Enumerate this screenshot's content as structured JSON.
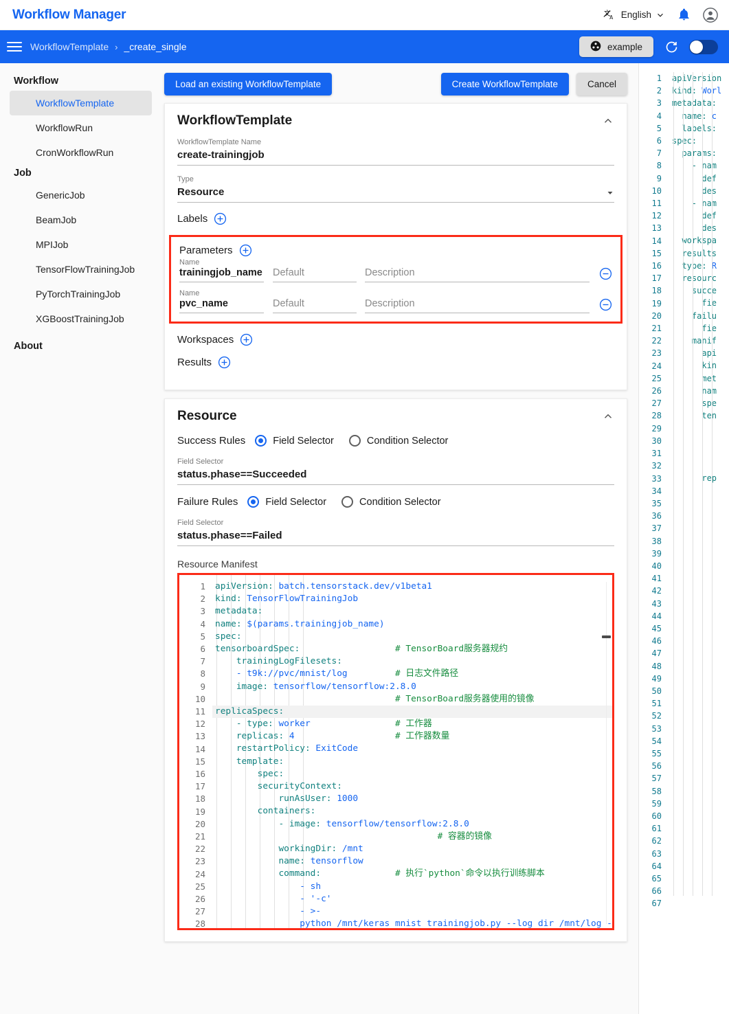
{
  "header": {
    "brand": "Workflow Manager",
    "language_icon": "translate-icon",
    "language": "English",
    "chevron": "chevron-down-icon",
    "bell": "bell-icon",
    "avatar": "account-circle-icon"
  },
  "toolbar": {
    "menu_icon": "hamburger-menu-icon",
    "breadcrumb_root": "WorkflowTemplate",
    "breadcrumb_sep": "›",
    "breadcrumb_current": "_create_single",
    "project_chip_icon": "project-icon",
    "project_chip_label": "example",
    "refresh_icon": "refresh-icon",
    "toggle_icon": "theme-toggle",
    "accent": "#1565f0"
  },
  "sidebar": {
    "groups": [
      {
        "label": "Workflow",
        "items": [
          {
            "label": "WorkflowTemplate",
            "active": true
          },
          {
            "label": "WorkflowRun",
            "active": false
          },
          {
            "label": "CronWorkflowRun",
            "active": false
          }
        ]
      },
      {
        "label": "Job",
        "items": [
          {
            "label": "GenericJob",
            "active": false
          },
          {
            "label": "BeamJob",
            "active": false
          },
          {
            "label": "MPIJob",
            "active": false
          },
          {
            "label": "TensorFlowTrainingJob",
            "active": false
          },
          {
            "label": "PyTorchTrainingJob",
            "active": false
          },
          {
            "label": "XGBoostTrainingJob",
            "active": false
          }
        ]
      }
    ],
    "about_label": "About"
  },
  "actions": {
    "load_existing": "Load an existing WorkflowTemplate",
    "create": "Create WorkflowTemplate",
    "cancel": "Cancel"
  },
  "template_card": {
    "title": "WorkflowTemplate",
    "collapse_icon": "chevron-up-icon",
    "name_label": "WorkflowTemplate Name",
    "name_value": "create-trainingjob",
    "type_label": "Type",
    "type_value": "Resource",
    "type_caret": "dropdown-caret-icon",
    "labels_label": "Labels",
    "labels_add_icon": "plus-circle-icon",
    "parameters_label": "Parameters",
    "parameters_add_icon": "plus-circle-icon",
    "parameters": [
      {
        "sublabel": "Name",
        "name": "trainingjob_name",
        "default_placeholder": "Default",
        "description_placeholder": "Description",
        "remove_icon": "minus-circle-icon"
      },
      {
        "sublabel": "Name",
        "name": "pvc_name",
        "default_placeholder": "Default",
        "description_placeholder": "Description",
        "remove_icon": "minus-circle-icon"
      }
    ],
    "workspaces_label": "Workspaces",
    "workspaces_add_icon": "plus-circle-icon",
    "results_label": "Results",
    "results_add_icon": "plus-circle-icon"
  },
  "resource_card": {
    "title": "Resource",
    "collapse_icon": "chevron-up-icon",
    "success_rules_label": "Success Rules",
    "success_field_selector_option": "Field Selector",
    "success_condition_selector_option": "Condition Selector",
    "success_selected": "Field Selector",
    "success_field_label": "Field Selector",
    "success_field_value": "status.phase==Succeeded",
    "failure_rules_label": "Failure Rules",
    "failure_field_selector_option": "Field Selector",
    "failure_condition_selector_option": "Condition Selector",
    "failure_selected": "Field Selector",
    "failure_field_label": "Field Selector",
    "failure_field_value": "status.phase==Failed",
    "manifest_label": "Resource Manifest"
  },
  "manifest_editor": {
    "first_line": 1,
    "last_visible_line": 28,
    "active_line": 11,
    "lines": [
      {
        "n": 1,
        "indent": 0,
        "text": "apiVersion: batch.tensorstack.dev/v1beta1",
        "key": "apiVersion",
        "value": "batch.tensorstack.dev/v1beta1",
        "comment": ""
      },
      {
        "n": 2,
        "indent": 0,
        "text": "kind: TensorFlowTrainingJob",
        "key": "kind",
        "value": "TensorFlowTrainingJob",
        "comment": ""
      },
      {
        "n": 3,
        "indent": 0,
        "text": "metadata:",
        "key": "metadata",
        "value": "",
        "comment": ""
      },
      {
        "n": 4,
        "indent": 0,
        "text": "name: $(params.trainingjob_name)",
        "key": "name",
        "value": "$(params.trainingjob_name)",
        "comment": ""
      },
      {
        "n": 5,
        "indent": 0,
        "text": "spec:",
        "key": "spec",
        "value": "",
        "comment": ""
      },
      {
        "n": 6,
        "indent": 0,
        "text": "tensorboardSpec:",
        "key": "tensorboardSpec",
        "value": "",
        "comment": "# TensorBoard服务器规约"
      },
      {
        "n": 7,
        "indent": 2,
        "text": "trainingLogFilesets:",
        "key": "trainingLogFilesets",
        "value": "",
        "comment": ""
      },
      {
        "n": 8,
        "indent": 2,
        "text": "- t9k://pvc/mnist/log",
        "key": "",
        "value": "- t9k://pvc/mnist/log",
        "comment": "# 日志文件路径"
      },
      {
        "n": 9,
        "indent": 2,
        "text": "image: tensorflow/tensorflow:2.8.0",
        "key": "image",
        "value": "tensorflow/tensorflow:2.8.0",
        "comment": ""
      },
      {
        "n": 10,
        "indent": 2,
        "text": "",
        "key": "",
        "value": "",
        "comment": "# TensorBoard服务器使用的镜像"
      },
      {
        "n": 11,
        "indent": 0,
        "text": "replicaSpecs:",
        "key": "replicaSpecs",
        "value": "",
        "comment": ""
      },
      {
        "n": 12,
        "indent": 2,
        "text": "- type: worker",
        "key": "type",
        "value": "worker",
        "comment": "# 工作器"
      },
      {
        "n": 13,
        "indent": 2,
        "text": "replicas: 4",
        "key": "replicas",
        "value": "4",
        "comment": "# 工作器数量"
      },
      {
        "n": 14,
        "indent": 2,
        "text": "restartPolicy: ExitCode",
        "key": "restartPolicy",
        "value": "ExitCode",
        "comment": ""
      },
      {
        "n": 15,
        "indent": 2,
        "text": "template:",
        "key": "template",
        "value": "",
        "comment": ""
      },
      {
        "n": 16,
        "indent": 4,
        "text": "spec:",
        "key": "spec",
        "value": "",
        "comment": ""
      },
      {
        "n": 17,
        "indent": 4,
        "text": "securityContext:",
        "key": "securityContext",
        "value": "",
        "comment": ""
      },
      {
        "n": 18,
        "indent": 6,
        "text": "runAsUser: 1000",
        "key": "runAsUser",
        "value": "1000",
        "comment": ""
      },
      {
        "n": 19,
        "indent": 4,
        "text": "containers:",
        "key": "containers",
        "value": "",
        "comment": ""
      },
      {
        "n": 20,
        "indent": 6,
        "text": "- image: tensorflow/tensorflow:2.8.0",
        "key": "image",
        "value": "tensorflow/tensorflow:2.8.0",
        "comment": ""
      },
      {
        "n": 21,
        "indent": 6,
        "text": "",
        "key": "",
        "value": "",
        "comment": "# 容器的镜像"
      },
      {
        "n": 22,
        "indent": 6,
        "text": "workingDir: /mnt",
        "key": "workingDir",
        "value": "/mnt",
        "comment": ""
      },
      {
        "n": 23,
        "indent": 6,
        "text": "name: tensorflow",
        "key": "name",
        "value": "tensorflow",
        "comment": ""
      },
      {
        "n": 24,
        "indent": 6,
        "text": "command:",
        "key": "command",
        "value": "",
        "comment": "# 执行`python`命令以执行训练脚本"
      },
      {
        "n": 25,
        "indent": 8,
        "text": "- sh",
        "key": "",
        "value": "- sh",
        "comment": ""
      },
      {
        "n": 26,
        "indent": 8,
        "text": "- '-c'",
        "key": "",
        "value": "- '-c'",
        "comment": ""
      },
      {
        "n": 27,
        "indent": 8,
        "text": "- >-",
        "key": "",
        "value": "- >-",
        "comment": ""
      },
      {
        "n": 28,
        "indent": 8,
        "text": "python /mnt/keras mnist trainingjob.py --log dir /mnt/log --save p",
        "key": "",
        "value": "python /mnt/keras mnist trainingjob.py --log dir /mnt/log --save p",
        "comment": ""
      }
    ]
  },
  "yaml_preview": {
    "first_line": 1,
    "last_line": 67,
    "lines": [
      {
        "n": 1,
        "text": "apiVersion",
        "key": "apiVersion",
        "value": ""
      },
      {
        "n": 2,
        "text": "kind: Worl",
        "key": "kind",
        "value": "Worl"
      },
      {
        "n": 3,
        "text": "metadata:",
        "key": "metadata",
        "value": ""
      },
      {
        "n": 4,
        "text": "  name: c",
        "key": "name",
        "value": "c"
      },
      {
        "n": 5,
        "text": "  labels:",
        "key": "labels",
        "value": ""
      },
      {
        "n": 6,
        "text": "spec:",
        "key": "spec",
        "value": ""
      },
      {
        "n": 7,
        "text": "  params:",
        "key": "params",
        "value": ""
      },
      {
        "n": 8,
        "text": "    - nam",
        "key": "",
        "value": "- nam"
      },
      {
        "n": 9,
        "text": "      def",
        "key": "def",
        "value": ""
      },
      {
        "n": 10,
        "text": "      des",
        "key": "des",
        "value": ""
      },
      {
        "n": 11,
        "text": "    - nam",
        "key": "",
        "value": "- nam"
      },
      {
        "n": 12,
        "text": "      def",
        "key": "def",
        "value": ""
      },
      {
        "n": 13,
        "text": "      des",
        "key": "des",
        "value": ""
      },
      {
        "n": 14,
        "text": "  workspa",
        "key": "workspa",
        "value": ""
      },
      {
        "n": 15,
        "text": "  results",
        "key": "results",
        "value": ""
      },
      {
        "n": 16,
        "text": "  type: R",
        "key": "type",
        "value": "R"
      },
      {
        "n": 17,
        "text": "  resourc",
        "key": "resourc",
        "value": ""
      },
      {
        "n": 18,
        "text": "    succe",
        "key": "succe",
        "value": ""
      },
      {
        "n": 19,
        "text": "      fie",
        "key": "fie",
        "value": ""
      },
      {
        "n": 20,
        "text": "    failu",
        "key": "failu",
        "value": ""
      },
      {
        "n": 21,
        "text": "      fie",
        "key": "fie",
        "value": ""
      },
      {
        "n": 22,
        "text": "    manif",
        "key": "manif",
        "value": ""
      },
      {
        "n": 23,
        "text": "      api",
        "key": "api",
        "value": ""
      },
      {
        "n": 24,
        "text": "      kin",
        "key": "kin",
        "value": ""
      },
      {
        "n": 25,
        "text": "      met",
        "key": "met",
        "value": ""
      },
      {
        "n": 26,
        "text": "      nam",
        "key": "nam",
        "value": ""
      },
      {
        "n": 27,
        "text": "      spe",
        "key": "spe",
        "value": ""
      },
      {
        "n": 28,
        "text": "      ten",
        "key": "ten",
        "value": ""
      },
      {
        "n": 29,
        "text": "",
        "key": "",
        "value": ""
      },
      {
        "n": 30,
        "text": "",
        "key": "",
        "value": ""
      },
      {
        "n": 31,
        "text": "",
        "key": "",
        "value": ""
      },
      {
        "n": 32,
        "text": "",
        "key": "",
        "value": ""
      },
      {
        "n": 33,
        "text": "      rep",
        "key": "rep",
        "value": ""
      },
      {
        "n": 34,
        "text": "",
        "key": "",
        "value": ""
      },
      {
        "n": 35,
        "text": "",
        "key": "",
        "value": ""
      },
      {
        "n": 36,
        "text": "",
        "key": "",
        "value": ""
      },
      {
        "n": 37,
        "text": "",
        "key": "",
        "value": ""
      },
      {
        "n": 38,
        "text": "",
        "key": "",
        "value": ""
      },
      {
        "n": 39,
        "text": "",
        "key": "",
        "value": ""
      },
      {
        "n": 40,
        "text": "",
        "key": "",
        "value": ""
      },
      {
        "n": 41,
        "text": "",
        "key": "",
        "value": ""
      },
      {
        "n": 42,
        "text": "",
        "key": "",
        "value": ""
      },
      {
        "n": 43,
        "text": "",
        "key": "",
        "value": ""
      },
      {
        "n": 44,
        "text": "",
        "key": "",
        "value": ""
      },
      {
        "n": 45,
        "text": "",
        "key": "",
        "value": ""
      },
      {
        "n": 46,
        "text": "",
        "key": "",
        "value": ""
      },
      {
        "n": 47,
        "text": "",
        "key": "",
        "value": ""
      },
      {
        "n": 48,
        "text": "",
        "key": "",
        "value": ""
      },
      {
        "n": 49,
        "text": "",
        "key": "",
        "value": ""
      },
      {
        "n": 50,
        "text": "",
        "key": "",
        "value": ""
      },
      {
        "n": 51,
        "text": "",
        "key": "",
        "value": ""
      },
      {
        "n": 52,
        "text": "",
        "key": "",
        "value": ""
      },
      {
        "n": 53,
        "text": "",
        "key": "",
        "value": ""
      },
      {
        "n": 54,
        "text": "",
        "key": "",
        "value": ""
      },
      {
        "n": 55,
        "text": "",
        "key": "",
        "value": ""
      },
      {
        "n": 56,
        "text": "",
        "key": "",
        "value": ""
      },
      {
        "n": 57,
        "text": "",
        "key": "",
        "value": ""
      },
      {
        "n": 58,
        "text": "",
        "key": "",
        "value": ""
      },
      {
        "n": 59,
        "text": "",
        "key": "",
        "value": ""
      },
      {
        "n": 60,
        "text": "",
        "key": "",
        "value": ""
      },
      {
        "n": 61,
        "text": "",
        "key": "",
        "value": ""
      },
      {
        "n": 62,
        "text": "",
        "key": "",
        "value": ""
      },
      {
        "n": 63,
        "text": "",
        "key": "",
        "value": ""
      },
      {
        "n": 64,
        "text": "",
        "key": "",
        "value": ""
      },
      {
        "n": 65,
        "text": "",
        "key": "",
        "value": ""
      },
      {
        "n": 66,
        "text": "",
        "key": "",
        "value": ""
      },
      {
        "n": 67,
        "text": "",
        "key": "",
        "value": ""
      }
    ]
  },
  "colors": {
    "accent_blue": "#1565f0",
    "highlight_red": "#fb2b18",
    "yaml_key": "#11817f",
    "yaml_value": "#1565f0",
    "yaml_comment": "#168c3e"
  }
}
